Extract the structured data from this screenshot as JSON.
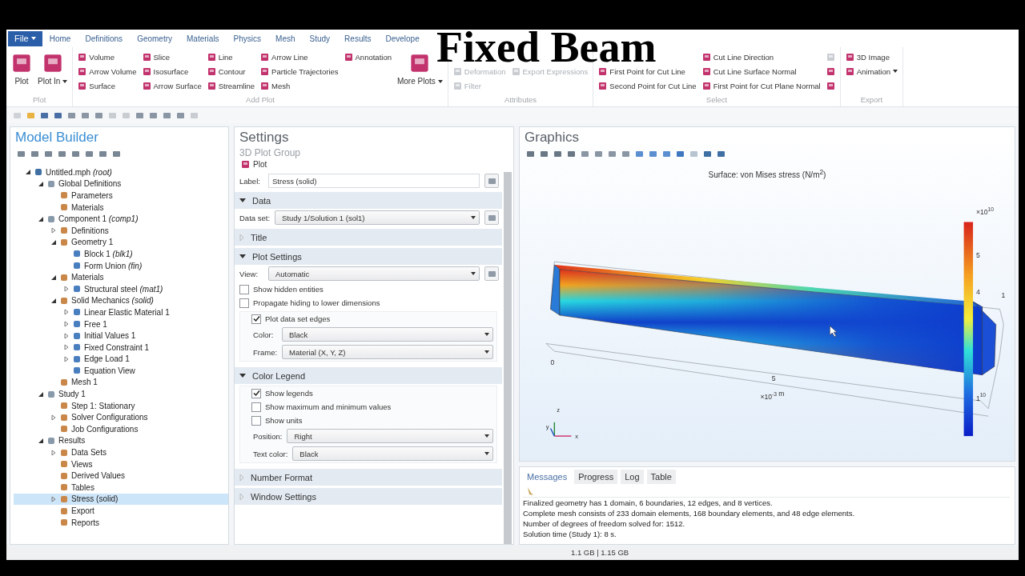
{
  "overlay_title": "Fixed Beam",
  "ribbon": {
    "file": "File",
    "tabs": [
      {
        "label": "Home"
      },
      {
        "label": "Definitions"
      },
      {
        "label": "Geometry"
      },
      {
        "label": "Materials"
      },
      {
        "label": "Physics"
      },
      {
        "label": "Mesh"
      },
      {
        "label": "Study"
      },
      {
        "label": "Results"
      },
      {
        "label": "Develope"
      }
    ],
    "groups": [
      {
        "title": "Plot",
        "columns": [
          {
            "kind": "large",
            "label": "Plot",
            "dropdown": false
          },
          {
            "kind": "large",
            "label": "Plot In",
            "dropdown": true
          }
        ]
      },
      {
        "title": "Add Plot",
        "columns": [
          {
            "kind": "stack",
            "items": [
              {
                "label": "Volume",
                "disabled": false
              },
              {
                "label": "Arrow Volume",
                "disabled": false
              },
              {
                "label": "Surface",
                "disabled": false
              }
            ]
          },
          {
            "kind": "stack",
            "items": [
              {
                "label": "Slice",
                "disabled": false
              },
              {
                "label": "Isosurface",
                "disabled": false
              },
              {
                "label": "Arrow Surface",
                "disabled": false
              }
            ]
          },
          {
            "kind": "stack",
            "items": [
              {
                "label": "Line",
                "disabled": false
              },
              {
                "label": "Contour",
                "disabled": false
              },
              {
                "label": "Streamline",
                "disabled": false
              }
            ]
          },
          {
            "kind": "stack",
            "items": [
              {
                "label": "Arrow Line",
                "disabled": false
              },
              {
                "label": "Particle Trajectories",
                "disabled": false
              },
              {
                "label": "Mesh",
                "disabled": false
              }
            ]
          },
          {
            "kind": "stack",
            "items": [
              {
                "label": "Annotation",
                "disabled": false
              }
            ]
          },
          {
            "kind": "large",
            "label": "More Plots",
            "dropdown": true
          }
        ]
      },
      {
        "title": "Attributes",
        "columns": [
          {
            "kind": "stack",
            "items": [
              {
                "label": "Deformation",
                "disabled": true
              },
              {
                "label": "Filter",
                "disabled": true
              }
            ]
          },
          {
            "kind": "stack",
            "items": [
              {
                "label": "Export Expressions",
                "disabled": true
              }
            ]
          }
        ]
      },
      {
        "title": "Select",
        "columns": [
          {
            "kind": "stack",
            "items": [
              {
                "label": "First Point for Cut Line",
                "disabled": false
              },
              {
                "label": "Second Point for Cut Line",
                "disabled": false
              }
            ]
          },
          {
            "kind": "stack",
            "items": [
              {
                "label": "Cut Line Direction",
                "disabled": false
              },
              {
                "label": "Cut Line Surface Normal",
                "disabled": false
              },
              {
                "label": "First Point for Cut Plane Normal",
                "disabled": false
              }
            ]
          },
          {
            "kind": "icons",
            "items": [
              {
                "disabled": true
              },
              {
                "disabled": false
              },
              {
                "disabled": false
              }
            ]
          }
        ]
      },
      {
        "title": "Export",
        "columns": [
          {
            "kind": "stack",
            "items": [
              {
                "label": "3D Image",
                "disabled": false
              },
              {
                "label": "Animation",
                "disabled": false,
                "dropdown": true
              }
            ]
          }
        ]
      }
    ]
  },
  "model_builder": {
    "title": "Model Builder",
    "tree": [
      {
        "label": "Untitled.mph *(root)*",
        "expanded": true,
        "selected": false,
        "children": [
          {
            "label": "Global Definitions",
            "expanded": true,
            "selected": false,
            "children": [
              {
                "label": "Parameters",
                "selected": false
              },
              {
                "label": "Materials",
                "selected": false
              }
            ]
          },
          {
            "label": "Component 1 *(comp1)*",
            "expanded": true,
            "selected": false,
            "children": [
              {
                "label": "Definitions",
                "expanded": false,
                "selected": false
              },
              {
                "label": "Geometry 1",
                "expanded": true,
                "selected": false,
                "children": [
                  {
                    "label": "Block 1 *(blk1)*",
                    "selected": false
                  },
                  {
                    "label": "Form Union *(fin)*",
                    "selected": false
                  }
                ]
              },
              {
                "label": "Materials",
                "expanded": true,
                "selected": false,
                "children": [
                  {
                    "label": "Structural steel *(mat1)*",
                    "expanded": false,
                    "selected": false
                  }
                ]
              },
              {
                "label": "Solid Mechanics *(solid)*",
                "expanded": true,
                "selected": false,
                "children": [
                  {
                    "label": "Linear Elastic Material 1",
                    "expanded": false,
                    "selected": false
                  },
                  {
                    "label": "Free 1",
                    "expanded": false,
                    "selected": false
                  },
                  {
                    "label": "Initial Values 1",
                    "expanded": false,
                    "selected": false
                  },
                  {
                    "label": "Fixed Constraint 1",
                    "expanded": false,
                    "selected": false
                  },
                  {
                    "label": "Edge Load 1",
                    "expanded": false,
                    "selected": false
                  },
                  {
                    "label": "Equation View",
                    "selected": false
                  }
                ]
              },
              {
                "label": "Mesh 1",
                "selected": false
              }
            ]
          },
          {
            "label": "Study 1",
            "expanded": true,
            "selected": false,
            "children": [
              {
                "label": "Step 1: Stationary",
                "selected": false
              },
              {
                "label": "Solver Configurations",
                "expanded": false,
                "selected": false
              },
              {
                "label": "Job Configurations",
                "selected": false
              }
            ]
          },
          {
            "label": "Results",
            "expanded": true,
            "selected": false,
            "children": [
              {
                "label": "Data Sets",
                "expanded": false,
                "selected": false
              },
              {
                "label": "Views",
                "selected": false
              },
              {
                "label": "Derived Values",
                "selected": false
              },
              {
                "label": "Tables",
                "selected": false
              },
              {
                "label": "Stress (solid)",
                "expanded": false,
                "selected": true
              },
              {
                "label": "Export",
                "selected": false
              },
              {
                "label": "Reports",
                "selected": false
              }
            ]
          }
        ]
      }
    ]
  },
  "settings": {
    "title": "Settings",
    "subtitle": "3D Plot Group",
    "plot_button": "Plot",
    "label_field": {
      "label": "Label:",
      "value": "Stress (solid)"
    },
    "sections": [
      {
        "title": "Data",
        "expanded": true,
        "rows": [
          {
            "kind": "select",
            "label": "Data set:",
            "value": "Study 1/Solution 1 (sol1)",
            "side_button": true
          }
        ]
      },
      {
        "title": "Title",
        "expanded": false
      },
      {
        "title": "Plot Settings",
        "expanded": true,
        "rows": [
          {
            "kind": "select",
            "label": "View:",
            "value": "Automatic",
            "side_button": true
          },
          {
            "kind": "check",
            "label": "Show hidden entities",
            "checked": false
          },
          {
            "kind": "check",
            "label": "Propagate hiding to lower dimensions",
            "checked": false
          },
          {
            "kind": "group",
            "rows": [
              {
                "kind": "check",
                "label": "Plot data set edges",
                "checked": true
              },
              {
                "kind": "select",
                "label": "Color:",
                "value": "Black"
              },
              {
                "kind": "select",
                "label": "Frame:",
                "value": "Material  (X, Y, Z)"
              }
            ]
          }
        ]
      },
      {
        "title": "Color Legend",
        "expanded": true,
        "rows": [
          {
            "kind": "group",
            "rows": [
              {
                "kind": "check",
                "label": "Show legends",
                "checked": true
              },
              {
                "kind": "check",
                "label": "Show maximum and minimum values",
                "checked": false
              },
              {
                "kind": "check",
                "label": "Show units",
                "checked": false
              },
              {
                "kind": "select",
                "label": "Position:",
                "value": "Right"
              },
              {
                "kind": "select",
                "label": "Text color:",
                "value": "Black"
              }
            ]
          }
        ]
      },
      {
        "title": "Number Format",
        "expanded": false
      },
      {
        "title": "Window Settings",
        "expanded": false
      }
    ]
  },
  "graphics": {
    "title": "Graphics",
    "plot_title": "Surface: von Mises stress (N/m$^{2}$)",
    "legend": {
      "multiplier": "×10$^{10}$",
      "ticks": [
        "5",
        "4",
        "1$^{10}$"
      ]
    },
    "axis_labels": [
      "0",
      "5",
      "×10$^{-3}$ m",
      "1"
    ],
    "triad": [
      "z",
      "y",
      "x"
    ]
  },
  "messages": {
    "tabs": [
      {
        "label": "Messages",
        "selected": true
      },
      {
        "label": "Progress",
        "selected": false
      },
      {
        "label": "Log",
        "selected": false
      },
      {
        "label": "Table",
        "selected": false
      }
    ],
    "lines": [
      "Finalized geometry has 1 domain, 6 boundaries, 12 edges, and 8 vertices.",
      "Complete mesh consists of 233 domain elements, 168 boundary elements, and 48 edge elements.",
      "Number of degrees of freedom solved for: 1512.",
      "Solution time (Study 1): 8 s."
    ]
  },
  "status_bar": "1.1 GB | 1.15 GB"
}
